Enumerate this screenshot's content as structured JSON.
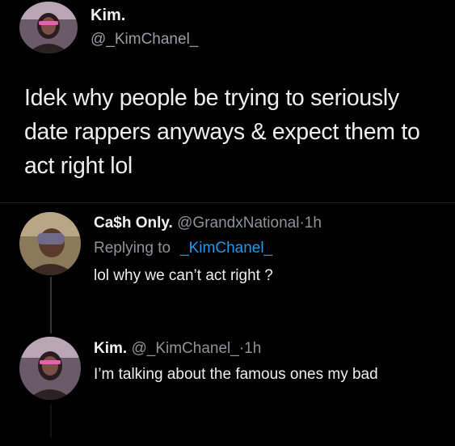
{
  "main_tweet": {
    "author_name": "Kim.",
    "author_handle": "@_KimChanel_",
    "text": "Idek why people be trying to seriously date rappers anyways & expect them to act right lol"
  },
  "reply_1": {
    "author_name": "Ca$h Only.",
    "author_handle": "@GrandxNational",
    "separator": "·",
    "time": "1h",
    "replying_to_label": "Replying to",
    "replying_to_handle": "_KimChanel_",
    "text": "lol why we can’t act right ?"
  },
  "reply_2": {
    "author_name": "Kim.",
    "author_handle": "@_KimChanel_",
    "separator": "·",
    "time": "1h",
    "text": "I’m talking about the famous ones my bad"
  },
  "colors": {
    "background": "#000000",
    "mention": "#1d9bf0",
    "secondary_text": "#8f9398"
  }
}
